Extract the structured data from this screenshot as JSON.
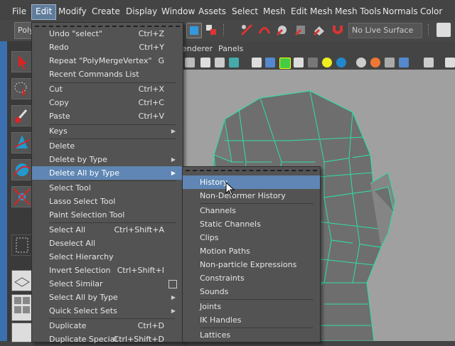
{
  "menubar": [
    "File",
    "Edit",
    "Modify",
    "Create",
    "Display",
    "Window",
    "Assets",
    "Select",
    "Mesh",
    "Edit Mesh",
    "Mesh Tools",
    "Normals",
    "Color"
  ],
  "toolbar": {
    "live_surface": "No Live Surface",
    "field_text": "Poly"
  },
  "panel_menu": [
    "enderer",
    "Panels"
  ],
  "edit_menu": {
    "items": [
      {
        "label": "Undo \"select\"",
        "shortcut": "Ctrl+Z"
      },
      {
        "label": "Redo",
        "shortcut": "Ctrl+Y"
      },
      {
        "label": "Repeat \"PolyMergeVertex\"",
        "shortcut": "G"
      },
      {
        "label": "Recent Commands List",
        "shortcut": ""
      },
      {
        "label": "Cut",
        "shortcut": "Ctrl+X"
      },
      {
        "label": "Copy",
        "shortcut": "Ctrl+C"
      },
      {
        "label": "Paste",
        "shortcut": "Ctrl+V"
      },
      {
        "label": "Keys",
        "shortcut": ""
      },
      {
        "label": "Delete",
        "shortcut": ""
      },
      {
        "label": "Delete by Type",
        "shortcut": ""
      },
      {
        "label": "Delete All by Type",
        "shortcut": ""
      },
      {
        "label": "Select Tool",
        "shortcut": ""
      },
      {
        "label": "Lasso Select Tool",
        "shortcut": ""
      },
      {
        "label": "Paint Selection Tool",
        "shortcut": ""
      },
      {
        "label": "Select All",
        "shortcut": "Ctrl+Shift+A"
      },
      {
        "label": "Deselect All",
        "shortcut": ""
      },
      {
        "label": "Select Hierarchy",
        "shortcut": ""
      },
      {
        "label": "Invert Selection",
        "shortcut": "Ctrl+Shift+I"
      },
      {
        "label": "Select Similar",
        "shortcut": ""
      },
      {
        "label": "Select All by Type",
        "shortcut": ""
      },
      {
        "label": "Quick Select Sets",
        "shortcut": ""
      },
      {
        "label": "Duplicate",
        "shortcut": "Ctrl+D"
      },
      {
        "label": "Duplicate Special",
        "shortcut": "Ctrl+Shift+D"
      }
    ]
  },
  "submenu": {
    "items": [
      "History",
      "Non-Deformer History",
      "Channels",
      "Static Channels",
      "Clips",
      "Motion Paths",
      "Non-particle Expressions",
      "Constraints",
      "Sounds",
      "Joints",
      "IK Handles",
      "Lattices"
    ]
  },
  "colors": {
    "highlight": "#5f86b4",
    "wireframe": "#30e0a0",
    "viewport": "#a0a0a0",
    "menu_bg": "#535353"
  }
}
